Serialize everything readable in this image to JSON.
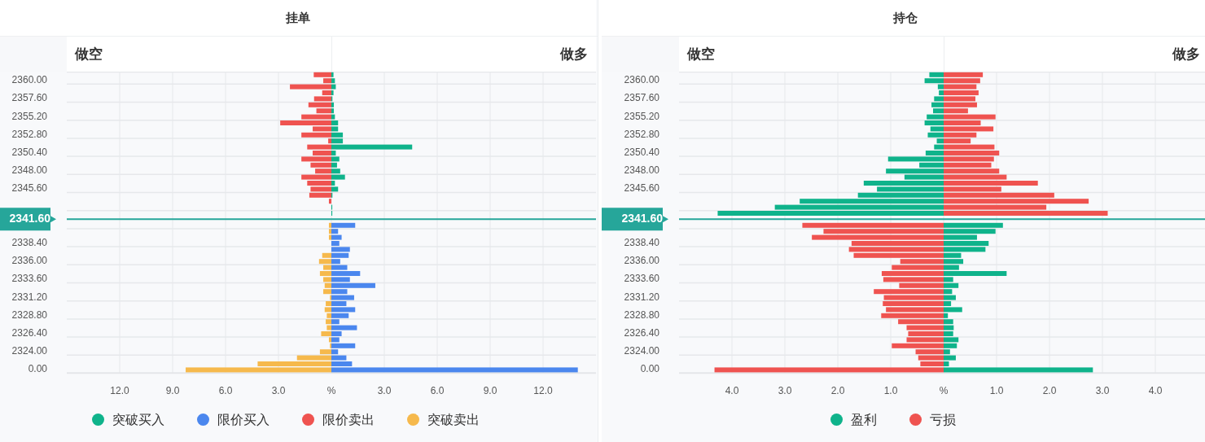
{
  "panels": [
    {
      "title": "挂单",
      "header": {
        "left": "做空",
        "right": "做多"
      },
      "chart_data": {
        "type": "bar",
        "orientation": "horizontal",
        "stacked": true,
        "grid": true,
        "categories": [
          null,
          "2360.00",
          null,
          null,
          "2357.60",
          null,
          null,
          "2355.20",
          null,
          null,
          "2352.80",
          null,
          null,
          "2350.40",
          null,
          null,
          "2348.00",
          null,
          null,
          "2345.60",
          null,
          null,
          null,
          null,
          "2341.60",
          null,
          null,
          null,
          "2338.40",
          null,
          null,
          "2336.00",
          null,
          null,
          "2333.60",
          null,
          null,
          "2331.20",
          null,
          null,
          "2328.80",
          null,
          null,
          "2326.40",
          null,
          null,
          "2324.00",
          null,
          null,
          "0.00"
        ],
        "series": [
          {
            "name": "突破买入",
            "color": "#0fb38b",
            "values": [
              0.12,
              0.2,
              0.25,
              0.12,
              0.06,
              0.14,
              0.14,
              0.2,
              0.38,
              0.38,
              0.65,
              0.65,
              4.58,
              0.25,
              0.45,
              0.32,
              0.5,
              0.77,
              0.2,
              0.38,
              0.06,
              null,
              0.05,
              0.05,
              null,
              null,
              null,
              null,
              null,
              null,
              null,
              null,
              null,
              null,
              null,
              null,
              null,
              null,
              null,
              null,
              null,
              null,
              null,
              null,
              null,
              null,
              null,
              null,
              null,
              null
            ]
          },
          {
            "name": "限价买入",
            "color": "#4b87ee",
            "values": [
              null,
              null,
              null,
              null,
              null,
              null,
              null,
              null,
              null,
              null,
              null,
              null,
              null,
              null,
              null,
              null,
              null,
              null,
              null,
              null,
              null,
              null,
              null,
              null,
              null,
              1.35,
              0.38,
              0.58,
              0.45,
              1.05,
              0.98,
              0.5,
              0.9,
              1.63,
              1.05,
              2.49,
              0.9,
              1.29,
              0.85,
              1.35,
              0.98,
              0.45,
              1.45,
              0.58,
              0.45,
              1.35,
              0.38,
              0.85,
              1.17,
              13.97
            ]
          },
          {
            "name": "限价卖出",
            "color": "#ef5350",
            "values": [
              -1.0,
              -0.46,
              -2.35,
              -0.52,
              -0.98,
              -1.3,
              -0.85,
              -1.7,
              -2.9,
              -1.06,
              -1.7,
              -0.18,
              -1.37,
              -1.06,
              -1.7,
              -1.18,
              -0.92,
              -1.7,
              -1.37,
              -1.18,
              -1.25,
              -0.14,
              null,
              null,
              null,
              null,
              null,
              null,
              null,
              null,
              null,
              null,
              null,
              null,
              null,
              null,
              null,
              null,
              null,
              null,
              null,
              null,
              null,
              null,
              null,
              null,
              null,
              null,
              null,
              null
            ]
          },
          {
            "name": "突破卖出",
            "color": "#f6b94c",
            "values": [
              null,
              null,
              null,
              null,
              null,
              null,
              null,
              null,
              null,
              null,
              null,
              null,
              null,
              null,
              null,
              null,
              null,
              null,
              null,
              null,
              null,
              null,
              null,
              null,
              null,
              -0.14,
              -0.14,
              -0.14,
              null,
              null,
              -0.52,
              -0.7,
              -0.46,
              -0.65,
              -0.46,
              -0.38,
              -0.46,
              -0.08,
              -0.32,
              -0.38,
              -0.26,
              -0.32,
              -0.26,
              -0.58,
              -0.14,
              -0.08,
              -0.65,
              -1.95,
              -4.18,
              -8.26
            ]
          }
        ],
        "xlim": [
          -15,
          15
        ],
        "xticks": [
          {
            "value": -12,
            "label": "12.0"
          },
          {
            "value": -9,
            "label": "9.0"
          },
          {
            "value": -6,
            "label": "6.0"
          },
          {
            "value": -3,
            "label": "3.0"
          },
          {
            "value": 0,
            "label": "%"
          },
          {
            "value": 3,
            "label": "3.0"
          },
          {
            "value": 6,
            "label": "6.0"
          },
          {
            "value": 9,
            "label": "9.0"
          },
          {
            "value": 12,
            "label": "12.0"
          }
        ],
        "ref_lines": [
          {
            "axis": "y",
            "value": "2341.60",
            "color": "#26a69a"
          }
        ]
      }
    },
    {
      "title": "持仓",
      "header": {
        "left": "做空",
        "right": "做多"
      },
      "chart_data": {
        "type": "bar",
        "orientation": "horizontal",
        "stacked": true,
        "grid": true,
        "categories": [
          null,
          "2360.00",
          null,
          null,
          "2357.60",
          null,
          null,
          "2355.20",
          null,
          null,
          "2352.80",
          null,
          null,
          "2350.40",
          null,
          null,
          "2348.00",
          null,
          null,
          "2345.60",
          null,
          null,
          null,
          null,
          "2341.60",
          null,
          null,
          null,
          "2338.40",
          null,
          null,
          "2336.00",
          null,
          null,
          "2333.60",
          null,
          null,
          "2331.20",
          null,
          null,
          "2328.80",
          null,
          null,
          "2326.40",
          null,
          null,
          "2324.00",
          null,
          null,
          "0.00"
        ],
        "series": [
          {
            "name": "盈利",
            "color": "#0fb38b",
            "values": [
              -0.27,
              -0.36,
              -0.11,
              -0.09,
              -0.18,
              -0.23,
              -0.2,
              -0.32,
              -0.36,
              -0.25,
              -0.3,
              -0.13,
              -0.18,
              -0.34,
              -1.05,
              -0.46,
              -1.09,
              -0.74,
              -1.51,
              -1.26,
              -1.62,
              -2.72,
              -3.19,
              -4.27,
              null,
              1.12,
              0.98,
              0.63,
              0.85,
              0.79,
              0.33,
              0.37,
              0.29,
              1.19,
              0.18,
              0.28,
              0.16,
              0.23,
              0.14,
              0.35,
              0.08,
              0.18,
              0.19,
              0.18,
              0.28,
              0.25,
              0.12,
              0.23,
              0.1,
              2.82
            ]
          },
          {
            "name": "亏损",
            "color": "#ef5350",
            "values": [
              0.74,
              0.69,
              0.62,
              0.66,
              0.6,
              0.63,
              0.46,
              0.98,
              0.7,
              0.94,
              0.62,
              0.51,
              0.96,
              1.05,
              0.95,
              0.9,
              1.05,
              1.19,
              1.78,
              1.09,
              2.09,
              2.74,
              1.94,
              3.1,
              null,
              -2.67,
              -2.27,
              -2.49,
              -1.74,
              -1.79,
              -1.7,
              -0.82,
              -0.98,
              -1.17,
              -1.14,
              -0.84,
              -1.32,
              -1.13,
              -1.15,
              -1.09,
              -1.18,
              -0.86,
              -0.7,
              -0.67,
              -0.7,
              -0.98,
              -0.53,
              -0.48,
              -0.44,
              -4.33
            ]
          }
        ],
        "xlim": [
          -5,
          5
        ],
        "xticks": [
          {
            "value": -4,
            "label": "4.0"
          },
          {
            "value": -3,
            "label": "3.0"
          },
          {
            "value": -2,
            "label": "2.0"
          },
          {
            "value": -1,
            "label": "1.0"
          },
          {
            "value": 0,
            "label": "%"
          },
          {
            "value": 1,
            "label": "1.0"
          },
          {
            "value": 2,
            "label": "2.0"
          },
          {
            "value": 3,
            "label": "3.0"
          },
          {
            "value": 4,
            "label": "4.0"
          }
        ],
        "ref_lines": [
          {
            "axis": "y",
            "value": "2341.60",
            "color": "#26a69a"
          }
        ]
      }
    }
  ]
}
